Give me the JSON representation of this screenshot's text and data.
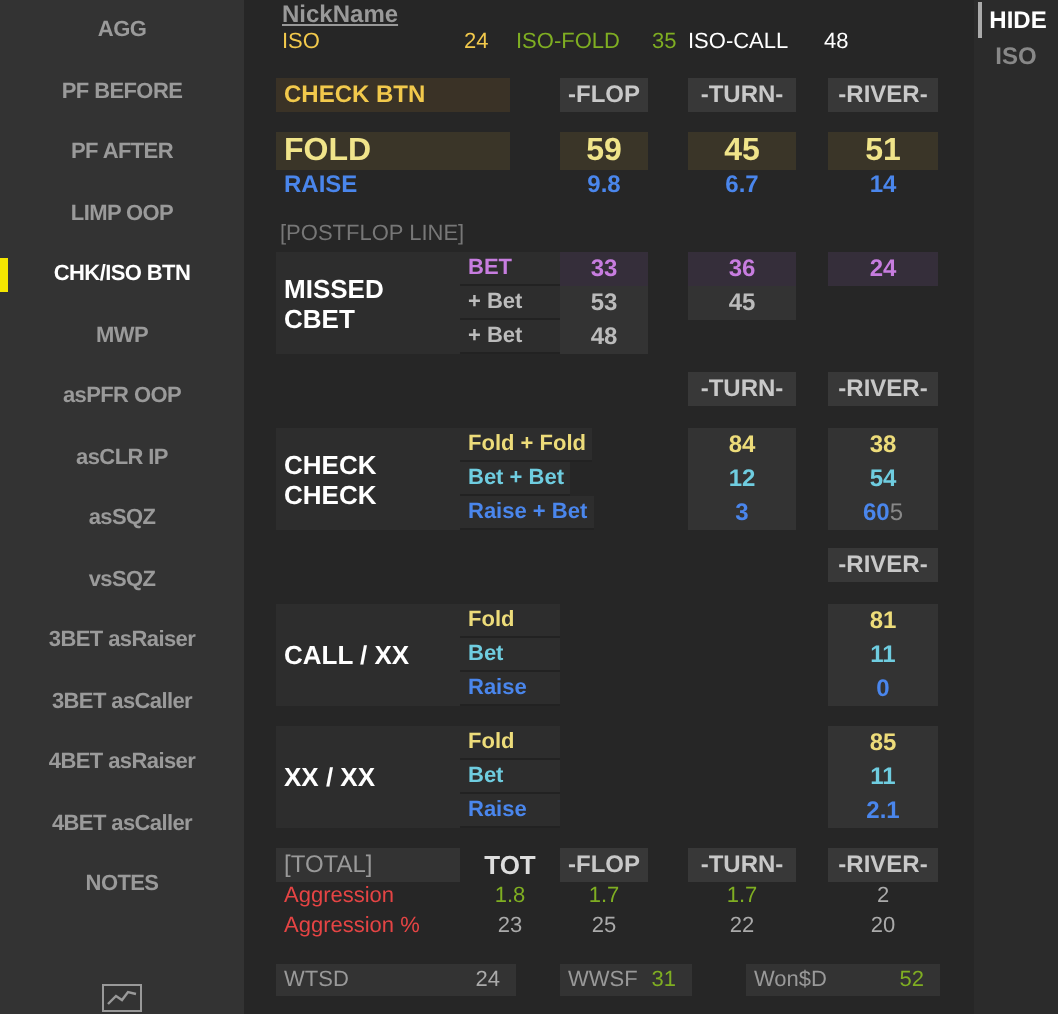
{
  "sidebar": {
    "items": [
      {
        "label": "AGG",
        "selected": false
      },
      {
        "label": "PF BEFORE",
        "selected": false
      },
      {
        "label": "PF AFTER",
        "selected": false
      },
      {
        "label": "LIMP OOP",
        "selected": false
      },
      {
        "label": "CHK/ISO BTN",
        "selected": true
      },
      {
        "label": "MWP",
        "selected": false
      },
      {
        "label": "asPFR OOP",
        "selected": false
      },
      {
        "label": "asCLR IP",
        "selected": false
      },
      {
        "label": "asSQZ",
        "selected": false
      },
      {
        "label": "vsSQZ",
        "selected": false
      },
      {
        "label": "3BET asRaiser",
        "selected": false
      },
      {
        "label": "3BET asCaller",
        "selected": false
      },
      {
        "label": "4BET asRaiser",
        "selected": false
      },
      {
        "label": "4BET asCaller",
        "selected": false
      },
      {
        "label": "NOTES",
        "selected": false
      }
    ]
  },
  "player": {
    "name": "NickName",
    "stats": [
      {
        "label": "ISO",
        "value": "24",
        "color": "#f2c94c"
      },
      {
        "label": "ISO-FOLD",
        "value": "35",
        "color": "#7fae22"
      },
      {
        "label": "ISO-CALL",
        "value": "48",
        "color": "#ffffff"
      }
    ]
  },
  "preflop": {
    "title": "CHECK BTN",
    "streets": [
      "-FLOP",
      "-TURN-",
      "-RIVER-"
    ],
    "fold": {
      "label": "FOLD",
      "values": [
        "59",
        "45",
        "51"
      ]
    },
    "raise": {
      "label": "RAISE",
      "values": [
        "9.8",
        "6.7",
        "14"
      ]
    }
  },
  "postflop": {
    "title": "[POSTFLOP LINE]",
    "blocks": [
      {
        "label": "MISSED CBET",
        "rows": [
          {
            "label": "BET",
            "kind": "bet",
            "cells": [
              "33",
              "36",
              "24"
            ]
          },
          {
            "label": "+ Bet",
            "kind": "plain",
            "cells": [
              "53",
              "45",
              null
            ]
          },
          {
            "label": "+ Bet",
            "kind": "plain",
            "cells": [
              "48",
              null,
              null
            ]
          }
        ]
      },
      {
        "headers": {
          "turn": "-TURN-",
          "river": "-RIVER-"
        },
        "label": "CHECK CHECK",
        "rows": [
          {
            "label": "Fold + Fold",
            "kind": "fold",
            "cells": [
              null,
              "84",
              "38"
            ]
          },
          {
            "label": "Bet + Bet",
            "kind": "call",
            "cells": [
              null,
              "12",
              "54"
            ]
          },
          {
            "label": "Raise + Bet",
            "kind": "raise",
            "cells": [
              null,
              "3",
              "60"
            ],
            "trail": "5"
          }
        ]
      },
      {
        "headers": {
          "river": "-RIVER-"
        },
        "label": "CALL / XX",
        "rows": [
          {
            "label": "Fold",
            "kind": "fold",
            "cells": [
              null,
              null,
              "81"
            ]
          },
          {
            "label": "Bet",
            "kind": "call",
            "cells": [
              null,
              null,
              "11"
            ]
          },
          {
            "label": "Raise",
            "kind": "raise",
            "cells": [
              null,
              null,
              "0"
            ]
          }
        ]
      },
      {
        "label": "XX / XX",
        "rows": [
          {
            "label": "Fold",
            "kind": "fold",
            "cells": [
              null,
              null,
              "85"
            ]
          },
          {
            "label": "Bet",
            "kind": "call",
            "cells": [
              null,
              null,
              "11"
            ]
          },
          {
            "label": "Raise",
            "kind": "raise",
            "cells": [
              null,
              null,
              "2.1"
            ]
          }
        ]
      }
    ]
  },
  "totals": {
    "title": "[TOTAL]",
    "columns": [
      "TOT",
      "-FLOP",
      "-TURN-",
      "-RIVER-"
    ],
    "rows": [
      {
        "label": "Aggression",
        "values": [
          {
            "text": "1.8",
            "color": "#7fae22"
          },
          {
            "text": "1.7",
            "color": "#7fae22"
          },
          {
            "text": "1.7",
            "color": "#7fae22"
          },
          {
            "text": "2",
            "color": "#aaaaaa"
          }
        ]
      },
      {
        "label": "Aggression %",
        "values": [
          {
            "text": "23",
            "color": "#aaaaaa"
          },
          {
            "text": "25",
            "color": "#aaaaaa"
          },
          {
            "text": "22",
            "color": "#aaaaaa"
          },
          {
            "text": "20",
            "color": "#aaaaaa"
          }
        ]
      }
    ]
  },
  "summary": [
    {
      "label": "WTSD",
      "value": "24",
      "color": "#aaaaaa"
    },
    {
      "label": "WWSF",
      "value": "31",
      "color": "#7fae22"
    },
    {
      "label": "Won$D",
      "value": "52",
      "color": "#7fae22"
    }
  ],
  "right_panel": {
    "buttons": [
      {
        "label": "HIDE",
        "selected": true
      },
      {
        "label": "ISO",
        "selected": false
      }
    ]
  }
}
